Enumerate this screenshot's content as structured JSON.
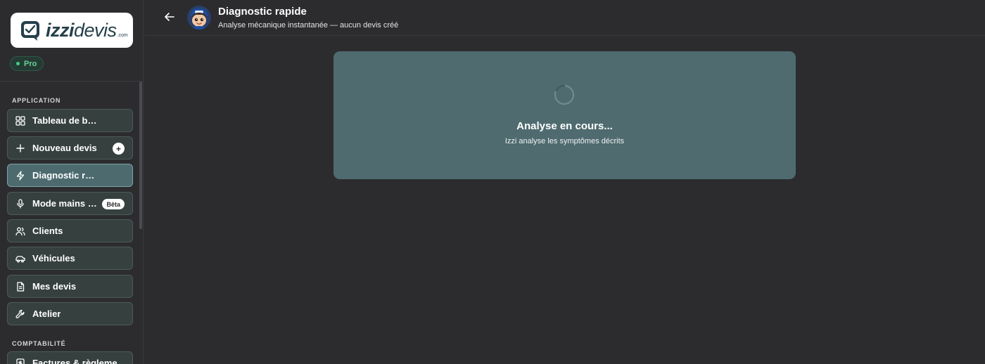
{
  "brand": {
    "name_bold": "izzi",
    "name_regular": "devis",
    "tld": ".com"
  },
  "plan": {
    "label": "Pro",
    "color": "#3fd07f"
  },
  "sidebar": {
    "section_app": "APPLICATION",
    "section_accounting": "COMPTABILITÉ",
    "items": [
      {
        "label": "Tableau de bord",
        "icon": "dashboard-icon"
      },
      {
        "label": "Nouveau devis",
        "icon": "plus-icon",
        "badge": "+"
      },
      {
        "label": "Diagnostic rapide",
        "icon": "lightning-icon",
        "active": true
      },
      {
        "label": "Mode mains libres",
        "icon": "microphone-icon",
        "badge": "Bêta"
      },
      {
        "label": "Clients",
        "icon": "users-icon"
      },
      {
        "label": "Véhicules",
        "icon": "car-icon"
      },
      {
        "label": "Mes devis",
        "icon": "document-icon"
      },
      {
        "label": "Atelier",
        "icon": "wrench-icon"
      }
    ],
    "accounting_items": [
      {
        "label": "Factures & règlements",
        "icon": "invoice-icon"
      }
    ]
  },
  "header": {
    "title": "Diagnostic rapide",
    "subtitle": "Analyse mécanique instantanée — aucun devis créé"
  },
  "analysis": {
    "title": "Analyse en cours...",
    "subtitle": "Izzi analyse les symptômes décrits"
  },
  "colors": {
    "background": "#2c2c2f",
    "card": "#4f6b70",
    "nav_item": "#36413f",
    "nav_active": "#4d6b6f",
    "logo_text": "#25404a"
  }
}
